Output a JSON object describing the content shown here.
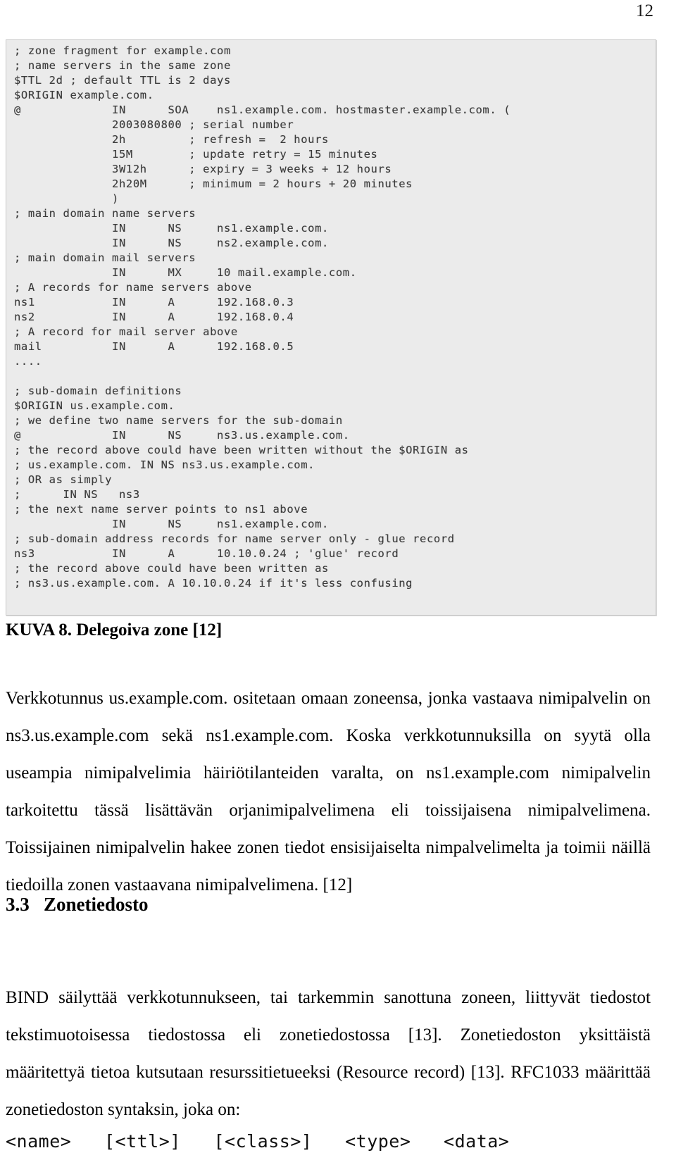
{
  "page": {
    "number": "12"
  },
  "figure": {
    "name": "dns-zone-file-screenshot",
    "caption": "KUVA 8. Delegoiva zone [12]",
    "code": "; zone fragment for example.com\n; name servers in the same zone\n$TTL 2d ; default TTL is 2 days\n$ORIGIN example.com.\n@             IN      SOA    ns1.example.com. hostmaster.example.com. (\n              2003080800 ; serial number\n              2h         ; refresh =  2 hours\n              15M        ; update retry = 15 minutes\n              3W12h      ; expiry = 3 weeks + 12 hours\n              2h20M      ; minimum = 2 hours + 20 minutes\n              )\n; main domain name servers\n              IN      NS     ns1.example.com.\n              IN      NS     ns2.example.com.\n; main domain mail servers\n              IN      MX     10 mail.example.com.\n; A records for name servers above\nns1           IN      A      192.168.0.3\nns2           IN      A      192.168.0.4\n; A record for mail server above\nmail          IN      A      192.168.0.5\n....\n\n; sub-domain definitions\n$ORIGIN us.example.com.\n; we define two name servers for the sub-domain\n@             IN      NS     ns3.us.example.com.\n; the record above could have been written without the $ORIGIN as\n; us.example.com. IN NS ns3.us.example.com.\n; OR as simply\n;      IN NS   ns3\n; the next name server points to ns1 above\n              IN      NS     ns1.example.com.\n; sub-domain address records for name server only - glue record\nns3           IN      A      10.10.0.24 ; 'glue' record\n; the record above could have been written as\n; ns3.us.example.com. A 10.10.0.24 if it's less confusing",
    "code_lines": [
      "; zone fragment for example.com",
      "; name servers in the same zone",
      "$TTL 2d ; default TTL is 2 days",
      "$ORIGIN example.com.",
      "@             IN      SOA    ns1.example.com. hostmaster.example.com. (",
      "              2003080800 ; serial number",
      "              2h         ; refresh =  2 hours",
      "              15M        ; update retry = 15 minutes",
      "              3W12h      ; expiry = 3 weeks + 12 hours",
      "              2h20M      ; minimum = 2 hours + 20 minutes",
      "              )",
      "; main domain name servers",
      "              IN      NS     ns1.example.com.",
      "              IN      NS     ns2.example.com.",
      "; main domain mail servers",
      "              IN      MX     10 mail.example.com.",
      "; A records for name servers above",
      "ns1           IN      A      192.168.0.3",
      "ns2           IN      A      192.168.0.4",
      "; A record for mail server above",
      "mail          IN      A      192.168.0.5",
      "....",
      "",
      "; sub-domain definitions",
      "$ORIGIN us.example.com.",
      "; we define two name servers for the sub-domain",
      "@             IN      NS     ns3.us.example.com.",
      "; the record above could have been written without the $ORIGIN as",
      "; us.example.com. IN NS ns3.us.example.com.",
      "; OR as simply",
      ";      IN NS   ns3",
      "; the next name server points to ns1 above",
      "              IN      NS     ns1.example.com.",
      "; sub-domain address records for name server only - glue record",
      "ns3           IN      A      10.10.0.24 ; 'glue' record",
      "; the record above could have been written as",
      "; ns3.us.example.com. A 10.10.0.24 if it's less confusing"
    ]
  },
  "body": {
    "paragraph_1": "Verkkotunnus us.example.com. ositetaan omaan zoneensa, jonka vastaava nimipalvelin on ns3.us.example.com sekä ns1.example.com. Koska verkkotunnuksilla on syytä olla useampia nimipalvelimia häiriötilanteiden varalta, on ns1.example.com nimipalvelin tarkoitettu tässä lisättävän orjanimipalvelimena eli toissijaisena nimipalvelimena. Toissijainen nimipalvelin hakee zonen tiedot ensisijaiselta nimpalvelimelta ja toimii näillä tiedoilla zonen vastaavana nimipalvelimena. [12]",
    "paragraph_2": "BIND säilyttää verkkotunnukseen, tai tarkemmin sanottuna zoneen, liittyvät tiedostot tekstimuotoisessa tiedostossa eli zonetiedostossa [13]. Zonetiedoston yksittäistä määritettyä tietoa kutsutaan resurssitietueeksi (Resource record) [13]. RFC1033 määrittää zonetiedoston syntaksin, joka on:"
  },
  "section": {
    "number": "3.3",
    "title": "Zonetiedosto",
    "full": "3.3   Zonetiedosto"
  },
  "syntax": {
    "line": "<name>   [<ttl>]   [<class>]   <type>   <data>"
  },
  "colors": {
    "page_background": "#ffffff",
    "figure_background": "#ebebeb",
    "figure_border": "#c9c9c9",
    "code_text": "#3b3b3b",
    "body_text": "#000000"
  }
}
